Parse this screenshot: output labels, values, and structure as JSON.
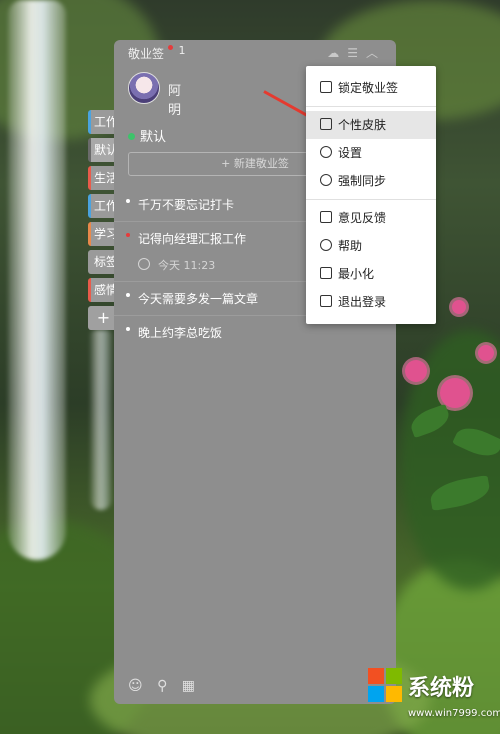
{
  "app": {
    "title": "敬业签",
    "notification_count": "1",
    "titlebar_icons": [
      "cloud-icon",
      "menu-icon",
      "collapse-icon"
    ]
  },
  "user": {
    "name": "阿明"
  },
  "side_tabs": [
    {
      "label": "工作"
    },
    {
      "label": "默认"
    },
    {
      "label": "生活"
    },
    {
      "label": "工作"
    },
    {
      "label": "学习"
    },
    {
      "label": "标签"
    },
    {
      "label": "感情"
    },
    {
      "label": "+"
    }
  ],
  "group": {
    "label": "默认",
    "new_note_button": "+ 新建敬业签"
  },
  "notes": [
    {
      "text": "千万不要忘记打卡"
    },
    {
      "text": "记得向经理汇报工作",
      "reminder": "今天 11:23"
    },
    {
      "text": "今天需要多发一篇文章"
    },
    {
      "text": "晚上约李总吃饭"
    }
  ],
  "footer_icons": [
    "contacts-icon",
    "search-icon",
    "calendar-icon"
  ],
  "menu": {
    "items": [
      {
        "label": "锁定敬业签",
        "icon": "lock-icon"
      },
      {
        "label": "个性皮肤",
        "icon": "shirt-icon"
      },
      {
        "label": "设置",
        "icon": "settings-icon"
      },
      {
        "label": "强制同步",
        "icon": "sync-icon"
      },
      {
        "label": "意见反馈",
        "icon": "mail-icon"
      },
      {
        "label": "帮助",
        "icon": "help-icon"
      },
      {
        "label": "最小化",
        "icon": "minimize-icon"
      },
      {
        "label": "退出登录",
        "icon": "logout-icon"
      }
    ]
  },
  "watermark": {
    "title": "系统粉",
    "url": "www.win7999.com"
  },
  "colors": {
    "panel": "#8e8e8e",
    "annotation_arrow": "#e53a2f",
    "notification_dot": "#e63b3b",
    "group_dot": "#3cc36a"
  }
}
